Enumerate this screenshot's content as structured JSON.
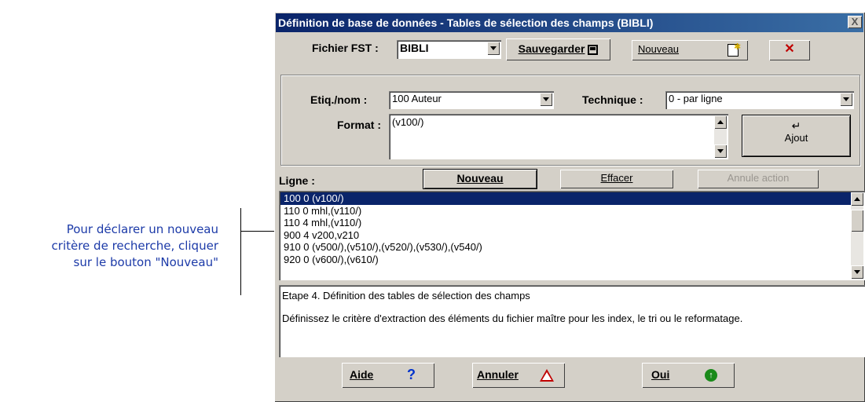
{
  "annotation": {
    "line1": "Pour déclarer un nouveau",
    "line2": "critère de recherche, cliquer",
    "line3": "sur le bouton \"Nouveau\""
  },
  "dialog": {
    "title": "Définition de base de données - Tables de sélection des champs (BIBLI)",
    "close_glyph": "X"
  },
  "top": {
    "fst_label": "Fichier FST :",
    "fst_value": "BIBLI",
    "save_label": "Sauvegarder",
    "new_label": "Nouveau"
  },
  "form": {
    "etiq_label": "Etiq./nom :",
    "etiq_value": "100 Auteur",
    "technique_label": "Technique :",
    "technique_value": "0 - par ligne",
    "format_label": "Format :",
    "format_value": "(v100/)",
    "add_label": "Ajout",
    "enter_glyph": "↵"
  },
  "line_section": {
    "label": "Ligne :",
    "new_label": "Nouveau",
    "clear_label": "Effacer",
    "undo_label": "Annule action"
  },
  "list": {
    "rows": [
      "100 0 (v100/)",
      "110 0 mhl,(v110/)",
      "110 4 mhl,(v110/)",
      "900 4 v200,v210",
      "910 0 (v500/),(v510/),(v520/),(v530/),(v540/)",
      "920 0 (v600/),(v610/)"
    ],
    "selected_index": 0
  },
  "info": {
    "step": "Etape 4. Définition des tables de sélection des champs",
    "description": "Définissez le critère d'extraction des éléments du fichier maître pour les index, le tri ou le reformatage."
  },
  "footer": {
    "help_label": "Aide",
    "help_glyph": "?",
    "cancel_label": "Annuler",
    "ok_label": "Oui",
    "ok_glyph": "↑"
  }
}
